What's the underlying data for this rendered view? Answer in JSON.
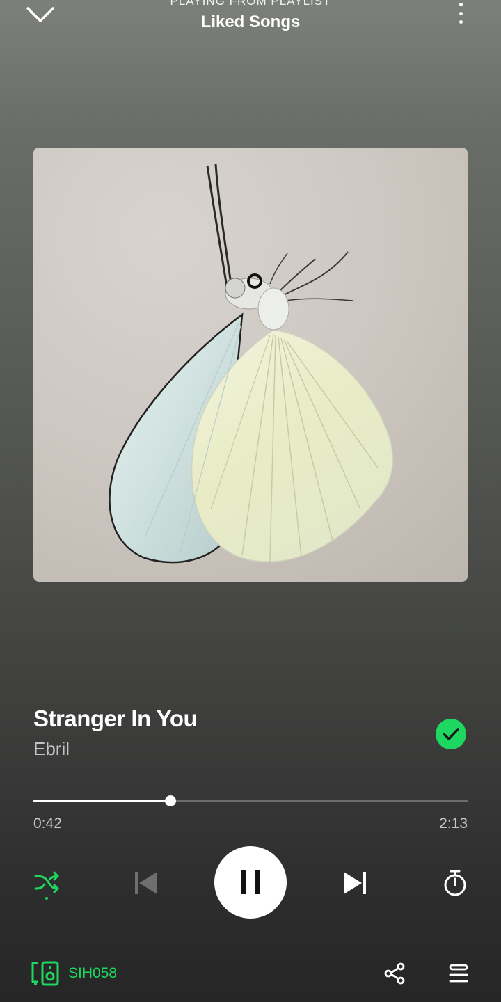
{
  "header": {
    "context_label": "PLAYING FROM PLAYLIST",
    "playlist_name": "Liked Songs"
  },
  "album_art": {
    "icon": "white-butterfly-album-art"
  },
  "track": {
    "title": "Stranger In You",
    "artist": "Ebril",
    "liked": true
  },
  "playback": {
    "elapsed": "0:42",
    "duration": "2:13",
    "progress_fraction": 0.316,
    "state": "playing"
  },
  "controls": {
    "shuffle_active": true,
    "icons": [
      "shuffle-icon",
      "previous-icon",
      "pause-icon",
      "next-icon",
      "sleep-timer-icon"
    ]
  },
  "footer": {
    "device_name": "SIH058",
    "icons": [
      "connect-device-icon",
      "share-icon",
      "queue-icon"
    ]
  },
  "colors": {
    "accent": "#1ed760",
    "text_primary": "#ffffff",
    "text_secondary": "#c4c4c4",
    "track_bg": "#6c6c6c"
  }
}
